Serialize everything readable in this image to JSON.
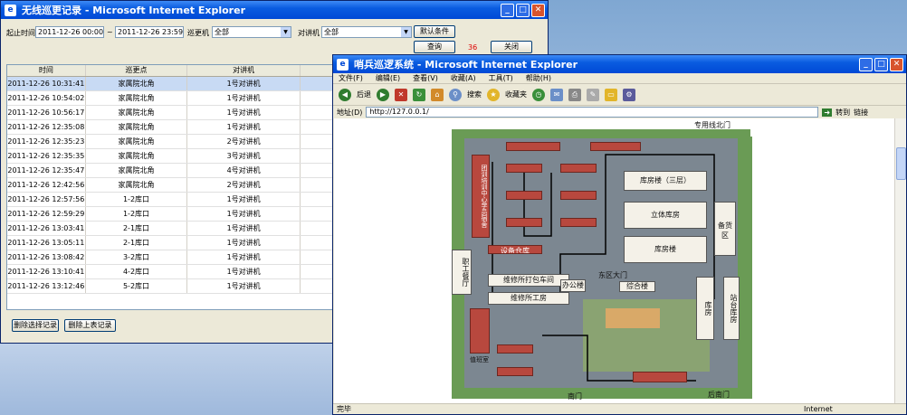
{
  "patrol_window": {
    "title": "无线巡更记录 - Microsoft Internet Explorer",
    "filter": {
      "start_label": "起止时间",
      "start_value": "2011-12-26 00:00:00",
      "separator": "~",
      "end_value": "2011-12-26 23:59:59",
      "patrol_point_label": "巡更机",
      "patrol_point_value": "全部",
      "intercom_label": "对讲机",
      "intercom_value": "全部",
      "default_button": "默认条件",
      "query_button": "查询",
      "count": "36",
      "close_button": "关闭"
    },
    "columns": [
      "时间",
      "巡更点",
      "对讲机"
    ],
    "rows": [
      [
        "2011-12-26 10:31:41",
        "家属院北角",
        "1号对讲机"
      ],
      [
        "2011-12-26 10:54:02",
        "家属院北角",
        "1号对讲机"
      ],
      [
        "2011-12-26 10:56:17",
        "家属院北角",
        "1号对讲机"
      ],
      [
        "2011-12-26 12:35:08",
        "家属院北角",
        "1号对讲机"
      ],
      [
        "2011-12-26 12:35:23",
        "家属院北角",
        "2号对讲机"
      ],
      [
        "2011-12-26 12:35:35",
        "家属院北角",
        "3号对讲机"
      ],
      [
        "2011-12-26 12:35:47",
        "家属院北角",
        "4号对讲机"
      ],
      [
        "2011-12-26 12:42:56",
        "家属院北角",
        "2号对讲机"
      ],
      [
        "2011-12-26 12:57:56",
        "1-2库口",
        "1号对讲机"
      ],
      [
        "2011-12-26 12:59:29",
        "1-2库口",
        "1号对讲机"
      ],
      [
        "2011-12-26 13:03:41",
        "2-1库口",
        "1号对讲机"
      ],
      [
        "2011-12-26 13:05:11",
        "2-1库口",
        "1号对讲机"
      ],
      [
        "2011-12-26 13:08:42",
        "3-2库口",
        "1号对讲机"
      ],
      [
        "2011-12-26 13:10:41",
        "4-2库口",
        "1号对讲机"
      ],
      [
        "2011-12-26 13:12:46",
        "5-2库口",
        "1号对讲机"
      ]
    ],
    "delete_selected_button": "删除选择记录",
    "delete_table_button": "删除上表记录"
  },
  "ie_window": {
    "title": "哨兵巡逻系统 - Microsoft Internet Explorer",
    "menu": [
      "文件(F)",
      "编辑(E)",
      "查看(V)",
      "收藏(A)",
      "工具(T)",
      "帮助(H)"
    ],
    "toolbar": {
      "back": "后退",
      "search": "搜索",
      "favorites": "收藏夹"
    },
    "address_label": "地址(D)",
    "address_value": "http://127.0.0.1/",
    "go_button": "转到",
    "links_label": "链接",
    "status_left": "完毕",
    "status_right": "Internet"
  },
  "map": {
    "north_gate": "专用线北门",
    "building_3f": "库房楼（三层）",
    "stereo_warehouse": "立体库房",
    "warehouse_building": "库房楼",
    "reserve_area": "备货区",
    "canteen": "职工餐厅",
    "training_center": "团训培训中心学员宿舍",
    "packing_workshop": "维修所打包车间",
    "repair_shop": "维修所工房",
    "office_building": "办公楼",
    "complex_building": "综合楼",
    "east_gate": "东区大门",
    "warehouse_side": "库房",
    "platform": "站台库房",
    "south_gate": "南门",
    "back_south_gate": "后南门",
    "guard": "值班室",
    "equipment": "设备仓库"
  }
}
